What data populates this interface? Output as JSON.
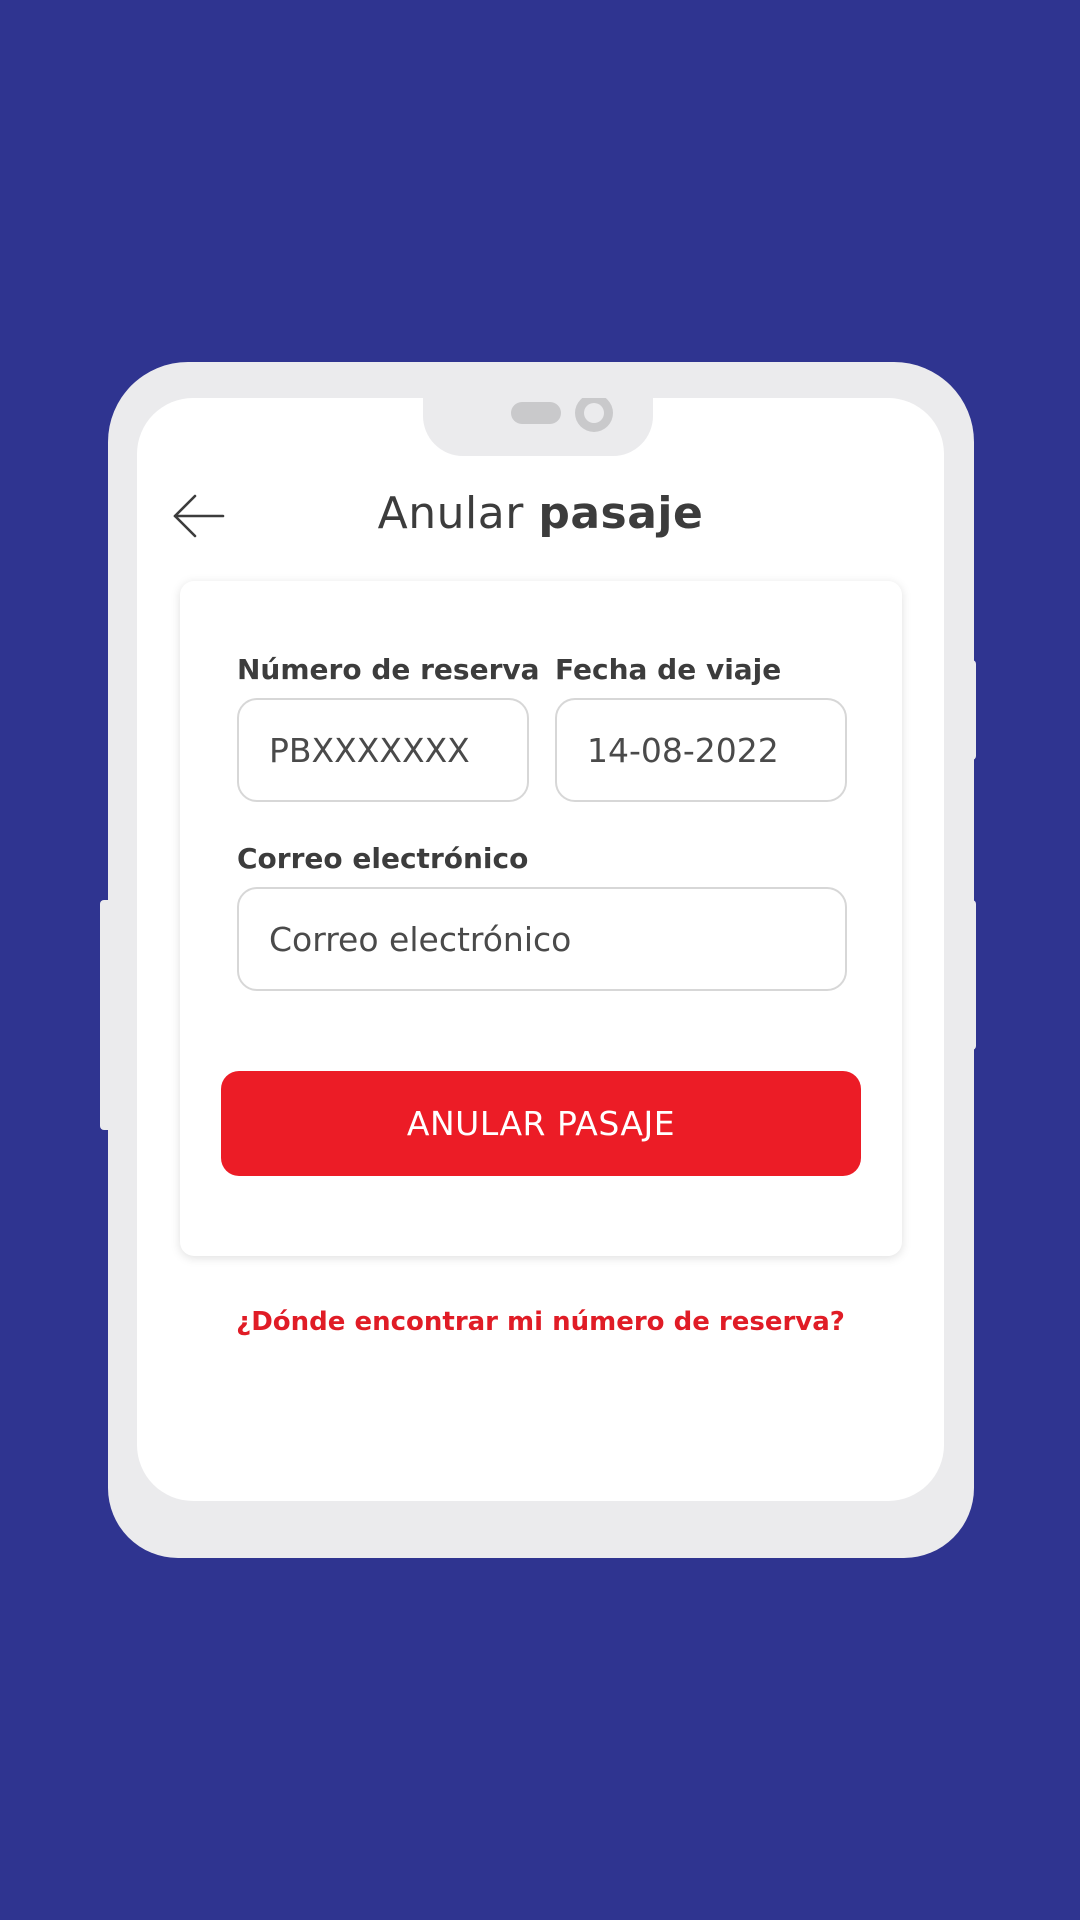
{
  "header": {
    "title_regular": "Anular",
    "title_bold": "pasaje",
    "back_icon": "arrow-left-icon"
  },
  "form": {
    "reservation_label": "Número de reserva",
    "reservation_placeholder": "PBXXXXXXX",
    "date_label": "Fecha de viaje",
    "date_placeholder": "14-08-2022",
    "email_label": "Correo electrónico",
    "email_placeholder": "Correo electrónico",
    "submit_label": "ANULAR PASAJE"
  },
  "help_link": "¿Dónde encontrar mi número de reserva?",
  "colors": {
    "background": "#2f3490",
    "accent": "#ec1c26",
    "text": "#3c3c3c"
  }
}
